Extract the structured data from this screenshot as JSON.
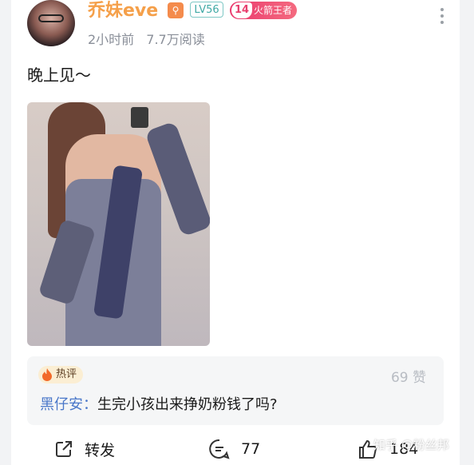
{
  "author": {
    "name": "乔妹eve",
    "key_badge_icon": "search-key-icon",
    "level": "LV56",
    "rank_number": "14",
    "rank_title": "火箭王者"
  },
  "post": {
    "time_ago": "2小时前",
    "reads": "7.7万阅读",
    "text": "晚上见～"
  },
  "hot_comment": {
    "tag": "热评",
    "likes": "69 赞",
    "author": "黑仔安：",
    "text": "生完小孩出来挣奶粉钱了吗?"
  },
  "actions": {
    "share_label": "转发",
    "comment_count": "77",
    "like_count": "184"
  },
  "watermark": "知乎 @粉丝邦",
  "colors": {
    "username": "#f5a04a",
    "level_badge": "#3fa9a5",
    "rank_badge": "#ea3a6e",
    "comment_author": "#4a77c9"
  }
}
